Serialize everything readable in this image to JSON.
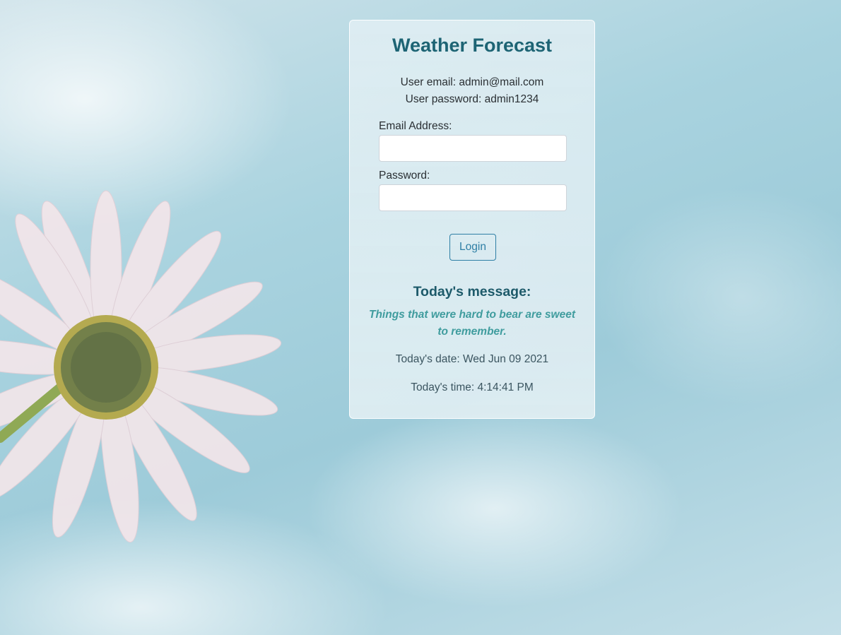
{
  "app": {
    "title": "Weather Forecast"
  },
  "credentials": {
    "email_line": "User email: admin@mail.com",
    "password_line": "User password: admin1234"
  },
  "form": {
    "email_label": "Email Address:",
    "email_value": "",
    "password_label": "Password:",
    "password_value": "",
    "login_label": "Login"
  },
  "message": {
    "heading": "Today's message:",
    "quote_line1": "Things that were hard to bear are sweet",
    "quote_line2": "to remember."
  },
  "status": {
    "date_line": "Today's date: Wed Jun 09 2021",
    "time_line": "Today's time: 4:14:41 PM"
  },
  "colors": {
    "title": "#1d6474",
    "accent_button": "#2e7fa5",
    "quote": "#3f9c9e",
    "sky": "#9dcbd9"
  },
  "icons": {
    "background_image": "daisy-flower-sky-background"
  }
}
